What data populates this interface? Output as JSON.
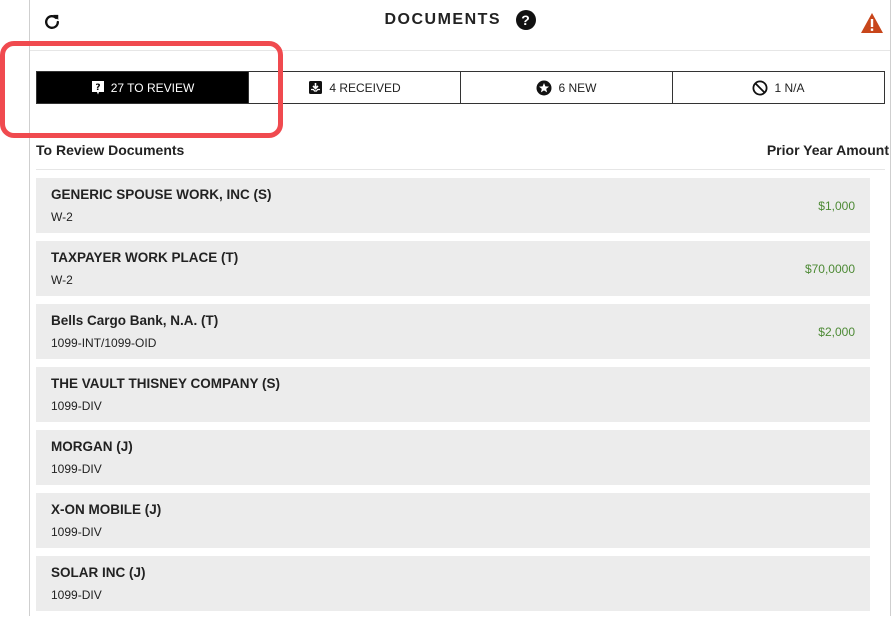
{
  "header": {
    "title": "DOCUMENTS",
    "help_glyph": "?"
  },
  "icons": {
    "refresh": "refresh-icon",
    "help": "question-circle-icon",
    "warning": "warning-triangle-icon"
  },
  "colors": {
    "accent_highlight": "#f04a4f",
    "amount_green": "#4d8a35",
    "warning_orange": "#c8461b",
    "active_tab_bg": "#000000"
  },
  "tabs": [
    {
      "label": "27 TO REVIEW",
      "icon": "question-box-icon",
      "active": true
    },
    {
      "label": "4 RECEIVED",
      "icon": "inbox-download-icon",
      "active": false
    },
    {
      "label": "6 NEW",
      "icon": "star-circle-icon",
      "active": false
    },
    {
      "label": "1 N/A",
      "icon": "ban-icon",
      "active": false
    }
  ],
  "list": {
    "left_header": "To Review Documents",
    "right_header": "Prior Year Amount",
    "rows": [
      {
        "name": "GENERIC SPOUSE WORK, INC (S)",
        "type": "W-2",
        "amount": "$1,000"
      },
      {
        "name": "TAXPAYER WORK PLACE (T)",
        "type": "W-2",
        "amount": "$70,0000"
      },
      {
        "name": "Bells Cargo Bank, N.A. (T)",
        "type": "1099-INT/1099-OID",
        "amount": "$2,000"
      },
      {
        "name": "THE VAULT THISNEY COMPANY (S)",
        "type": "1099-DIV",
        "amount": ""
      },
      {
        "name": "MORGAN (J)",
        "type": "1099-DIV",
        "amount": ""
      },
      {
        "name": "X-ON MOBILE (J)",
        "type": "1099-DIV",
        "amount": ""
      },
      {
        "name": "SOLAR INC (J)",
        "type": "1099-DIV",
        "amount": ""
      }
    ]
  }
}
